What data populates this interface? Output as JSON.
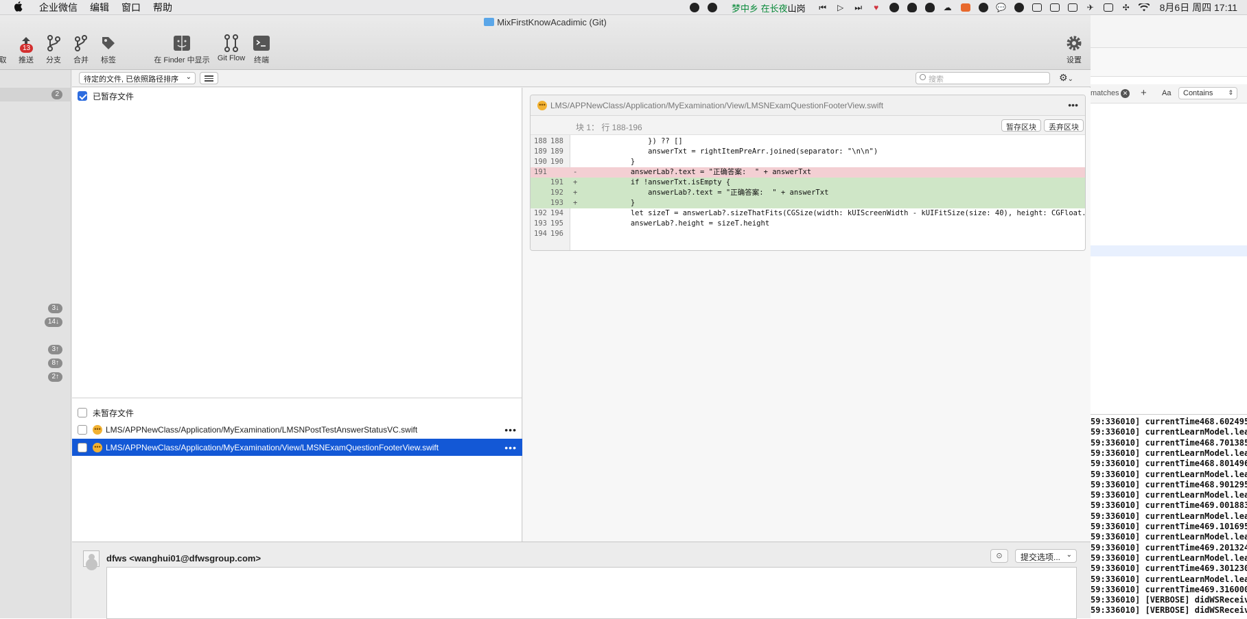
{
  "menubar": {
    "apple": "",
    "items": [
      "企业微信",
      "编辑",
      "窗口",
      "帮助"
    ],
    "music_song": "梦中乡 在长夜",
    "music_artist": "山岗",
    "clock": "8月6日 周四  17:11"
  },
  "window": {
    "title": "MixFirstKnowAcadimic (Git)",
    "toolbar": {
      "fetch_label": "取",
      "push_label": "推送",
      "push_badge": "13",
      "branch_label": "分支",
      "merge_label": "合并",
      "tag_label": "标签",
      "finder_label": "在 Finder 中显示",
      "gitflow_label": "Git Flow",
      "terminal_label": "终端",
      "settings_label": "设置"
    }
  },
  "sidebar": {
    "badges": [
      "2",
      "3↓",
      "14↓",
      "3↑",
      "8↑",
      "2↑"
    ]
  },
  "filelist": {
    "sort_select": "待定的文件, 已依照路径排序",
    "search_placeholder": "搜索",
    "staged_header": "已暂存文件",
    "unstaged_header": "未暂存文件",
    "unstaged_files": [
      "LMS/APPNewClass/Application/MyExamination/LMSNPostTestAnswerStatusVC.swift",
      "LMS/APPNewClass/Application/MyExamination/View/LMSNExamQuestionFooterView.swift"
    ],
    "more": "•••"
  },
  "diff": {
    "file_path": "LMS/APPNewClass/Application/MyExamination/View/LMSNExamQuestionFooterView.swift",
    "hunk_title": "块 1： 行 188-196",
    "stage_hunk": "暂存区块",
    "discard_hunk": "丢弃区块",
    "more": "•••",
    "lines": [
      {
        "old": "188",
        "new": "188",
        "mark": "",
        "type": "ctx",
        "code": "                }) ?? []"
      },
      {
        "old": "189",
        "new": "189",
        "mark": "",
        "type": "ctx",
        "code": "                answerTxt = rightItemPreArr.joined(separator: \"\\n\\n\")"
      },
      {
        "old": "190",
        "new": "190",
        "mark": "",
        "type": "ctx",
        "code": "            }"
      },
      {
        "old": "191",
        "new": "",
        "mark": "-",
        "type": "del",
        "code": "            answerLab?.text = \"正确答案:  \" + answerTxt"
      },
      {
        "old": "",
        "new": "191",
        "mark": "+",
        "type": "add",
        "code": "            if !answerTxt.isEmpty {"
      },
      {
        "old": "",
        "new": "192",
        "mark": "+",
        "type": "add",
        "code": "                answerLab?.text = \"正确答案:  \" + answerTxt"
      },
      {
        "old": "",
        "new": "193",
        "mark": "+",
        "type": "add",
        "code": "            }"
      },
      {
        "old": "192",
        "new": "194",
        "mark": "",
        "type": "ctx",
        "code": "            let sizeT = answerLab?.sizeThatFits(CGSize(width: kUIScreenWidth - kUIFitSize(size: 40), height: CGFloat.greate"
      },
      {
        "old": "193",
        "new": "195",
        "mark": "",
        "type": "ctx",
        "code": "            answerLab?.height = sizeT.height"
      },
      {
        "old": "194",
        "new": "196",
        "mark": "",
        "type": "ctx",
        "code": ""
      }
    ]
  },
  "commit": {
    "author": "dfws <wanghui01@dfwsgroup.com>",
    "options_label": "提交选项...",
    "clock_icon": "⊙"
  },
  "background_app": {
    "find_text": "matches",
    "aa": "Aa",
    "contains": "Contains",
    "console_lines": [
      "59:336010] currentTime468.602495",
      "59:336010] currentLearnModel.lea",
      "59:336010] currentTime468.701385",
      "59:336010] currentLearnModel.lea",
      "59:336010] currentTime468.801496",
      "59:336010] currentLearnModel.lea",
      "59:336010] currentTime468.901295",
      "59:336010] currentLearnModel.lea",
      "59:336010] currentTime469.001883",
      "59:336010] currentLearnModel.lea",
      "59:336010] currentTime469.101695",
      "59:336010] currentLearnModel.lea",
      "59:336010] currentTime469.201324",
      "59:336010] currentLearnModel.lea",
      "59:336010] currentTime469.301230",
      "59:336010] currentLearnModel.lea",
      "59:336010] currentTime469.316000",
      "59:336010] [VERBOSE] didWSReceiv",
      "59:336010] [VERBOSE] didWSReceiv"
    ]
  }
}
